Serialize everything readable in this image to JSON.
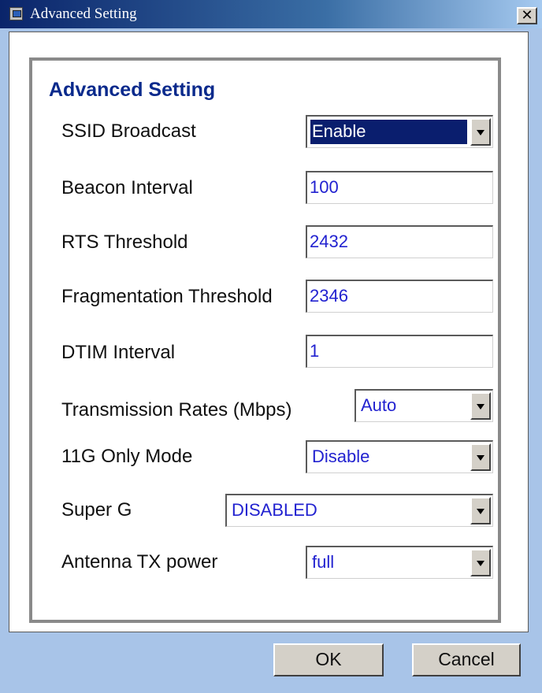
{
  "window": {
    "title": "Advanced Setting",
    "close_label": "✕"
  },
  "fieldset": {
    "legend": "Advanced Setting"
  },
  "fields": {
    "ssid_broadcast": {
      "label": "SSID Broadcast",
      "value": "Enable"
    },
    "beacon_interval": {
      "label": "Beacon Interval",
      "value": "100"
    },
    "rts_threshold": {
      "label": "RTS Threshold",
      "value": "2432"
    },
    "fragmentation_threshold": {
      "label": "Fragmentation Threshold",
      "value": "2346"
    },
    "dtim_interval": {
      "label": "DTIM Interval",
      "value": "1"
    },
    "transmission_rates": {
      "label": "Transmission Rates (Mbps)",
      "value": "Auto"
    },
    "only_11g_mode": {
      "label": "11G Only Mode",
      "value": "Disable"
    },
    "super_g": {
      "label": "Super G",
      "value": "DISABLED"
    },
    "antenna_tx_power": {
      "label": "Antenna TX power",
      "value": "full"
    }
  },
  "buttons": {
    "ok": "OK",
    "cancel": "Cancel"
  },
  "icons": {
    "app": "app-window-icon",
    "close": "close-icon",
    "dropdown": "chevron-down-icon"
  },
  "colors": {
    "title_bar": "#0a246a",
    "legend": "#0a2a8c",
    "field_value": "#2222d0",
    "dialog_background": "#a8c4e8"
  }
}
